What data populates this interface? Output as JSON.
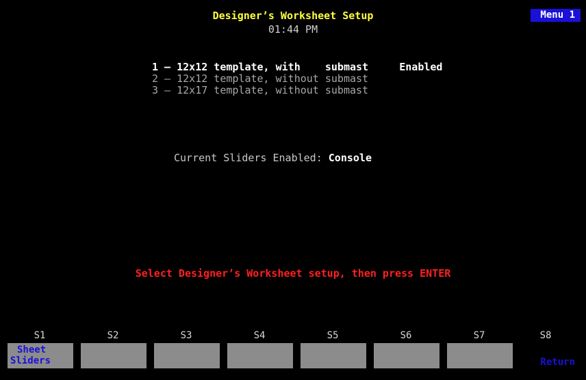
{
  "header": {
    "title": "Designer’s Worksheet Setup",
    "time": "01:44 PM",
    "menu_badge": "Menu 1"
  },
  "options": [
    {
      "text": "1 – 12x12 template, with    submast     Enabled",
      "selected": true
    },
    {
      "text": "2 – 12x12 template, without submast",
      "selected": false
    },
    {
      "text": "3 – 12x17 template, without submast",
      "selected": false
    }
  ],
  "status": {
    "label": "Current Sliders Enabled:",
    "value": "Console"
  },
  "prompt": "Select Designer’s Worksheet setup, then press ENTER",
  "soft_keys": [
    {
      "id": "S1",
      "line1": "Sheet",
      "line2": "Sliders"
    },
    {
      "id": "S2",
      "line1": "",
      "line2": ""
    },
    {
      "id": "S3",
      "line1": "",
      "line2": ""
    },
    {
      "id": "S4",
      "line1": "",
      "line2": ""
    },
    {
      "id": "S5",
      "line1": "",
      "line2": ""
    },
    {
      "id": "S6",
      "line1": "",
      "line2": ""
    },
    {
      "id": "S7",
      "line1": "",
      "line2": ""
    },
    {
      "id": "S8",
      "line1": "",
      "line2": "Return"
    }
  ],
  "colors": {
    "background": "#000000",
    "title": "#ffff40",
    "prompt": "#ff2020",
    "softkey_face": "#8c8c8c",
    "softkey_text": "#1a10d8",
    "menu_badge": "#1a10d8"
  }
}
